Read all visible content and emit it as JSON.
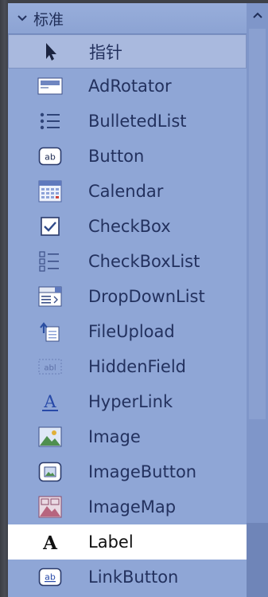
{
  "toolbox": {
    "group_title": "标准",
    "items": [
      {
        "label": "指针",
        "icon": "pointer-arrow-icon"
      },
      {
        "label": "AdRotator",
        "icon": "adrotator-icon"
      },
      {
        "label": "BulletedList",
        "icon": "bulleted-list-icon"
      },
      {
        "label": "Button",
        "icon": "button-ab-icon"
      },
      {
        "label": "Calendar",
        "icon": "calendar-icon"
      },
      {
        "label": "CheckBox",
        "icon": "checkbox-icon"
      },
      {
        "label": "CheckBoxList",
        "icon": "checkbox-list-icon"
      },
      {
        "label": "DropDownList",
        "icon": "dropdown-list-icon"
      },
      {
        "label": "FileUpload",
        "icon": "file-upload-icon"
      },
      {
        "label": "HiddenField",
        "icon": "hidden-field-icon"
      },
      {
        "label": "HyperLink",
        "icon": "hyperlink-icon"
      },
      {
        "label": "Image",
        "icon": "image-icon"
      },
      {
        "label": "ImageButton",
        "icon": "image-button-icon"
      },
      {
        "label": "ImageMap",
        "icon": "image-map-icon"
      },
      {
        "label": "Label",
        "icon": "label-a-icon"
      },
      {
        "label": "LinkButton",
        "icon": "link-button-icon"
      }
    ],
    "selected_index": 14
  },
  "colors": {
    "panel": "#8fa6d6",
    "selected": "#ffffff",
    "text": "#23315e"
  }
}
